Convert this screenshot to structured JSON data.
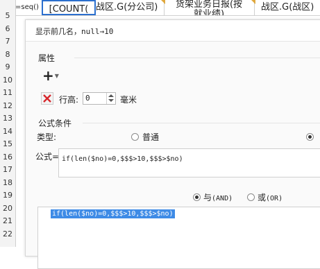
{
  "spreadsheet": {
    "top_cells": [
      "=seq()",
      "[COUNT(",
      "战区.G(分公司)",
      "货架业务日报(按",
      "战区.G(战区)"
    ],
    "row_numbers": [
      "5",
      "6",
      "7",
      "8",
      "9",
      "10",
      "11",
      "12",
      "13",
      "14",
      "15",
      "16",
      "17",
      "18",
      "19",
      "20",
      "21",
      "22"
    ],
    "cell_sub": "就业绩)"
  },
  "dialog": {
    "title": "显示前几名，null→10",
    "attr_section": "属性",
    "row_height_label": "行高:",
    "row_height_value": "0",
    "row_height_unit": "毫米",
    "condition_section": "公式条件",
    "type_label": "类型:",
    "type_option_normal": "普通",
    "formula_label": "公式=",
    "formula_value": "if(len($no)=0,$$$>10,$$$>$no)",
    "logic_and": "与",
    "logic_and_code": "(AND)",
    "logic_or": "或",
    "logic_or_code": "(OR)",
    "result_text": "if(len($no)=0,$$$>10,$$$>$no)"
  },
  "colors": {
    "accent": "#3e8be6",
    "delete": "#d7262b",
    "selection": "#2b6fce"
  }
}
